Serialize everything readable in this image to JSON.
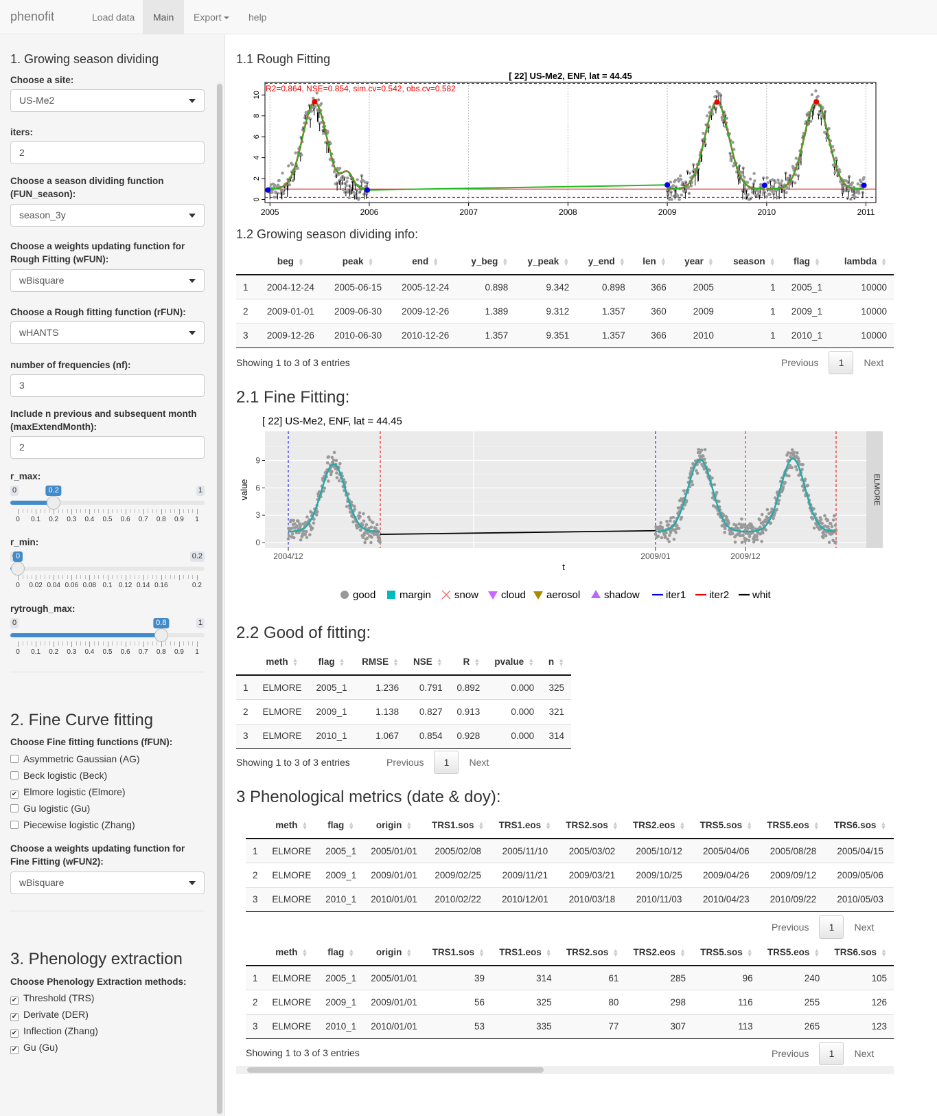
{
  "navbar": {
    "brand": "phenofit",
    "items": [
      "Load data",
      "Main",
      "Export",
      "help"
    ]
  },
  "sidebar": {
    "s1_title": "1. Growing season dividing",
    "site_label": "Choose a site:",
    "site_value": "US-Me2",
    "iters_label": "iters:",
    "iters_value": "2",
    "funseason_label": "Choose a season dividing function (FUN_season):",
    "funseason_value": "season_3y",
    "wfun_label": "Choose a weights updating function for Rough Fitting (wFUN):",
    "wfun_value": "wBisquare",
    "rfun_label": "Choose a Rough fitting function (rFUN):",
    "rfun_value": "wHANTS",
    "nf_label": "number of frequencies (nf):",
    "nf_value": "3",
    "maxext_label": "Include n previous and subsequent month (maxExtendMonth):",
    "maxext_value": "2",
    "sliders": [
      {
        "label": "r_max:",
        "min": "0",
        "max": "1",
        "value": "0.2",
        "value_num": 0.2,
        "min_num": 0,
        "max_num": 1,
        "ticks": [
          "0",
          "0.1",
          "0.2",
          "0.3",
          "0.4",
          "0.5",
          "0.6",
          "0.7",
          "0.8",
          "0.9",
          "1"
        ]
      },
      {
        "label": "r_min:",
        "min": "0",
        "max": "0.2",
        "value": "0",
        "value_num": 0,
        "min_num": 0,
        "max_num": 0.2,
        "ticks": [
          "0",
          "0.02",
          "0.04",
          "0.06",
          "0.08",
          "0.1",
          "0.12",
          "0.14",
          "0.16",
          "0.2"
        ]
      },
      {
        "label": "rytrough_max:",
        "min": "0",
        "max": "1",
        "value": "0.8",
        "value_num": 0.8,
        "min_num": 0,
        "max_num": 1,
        "ticks": [
          "0",
          "0.1",
          "0.2",
          "0.3",
          "0.4",
          "0.5",
          "0.6",
          "0.7",
          "0.8",
          "0.9",
          "1"
        ]
      }
    ],
    "s2_title": "2. Fine Curve fitting",
    "ffun_label": "Choose Fine fitting functions (fFUN):",
    "ffun_options": [
      {
        "label": "Asymmetric Gaussian (AG)",
        "checked": false
      },
      {
        "label": "Beck logistic (Beck)",
        "checked": false
      },
      {
        "label": "Elmore logistic (Elmore)",
        "checked": true
      },
      {
        "label": "Gu logistic (Gu)",
        "checked": false
      },
      {
        "label": "Piecewise logistic (Zhang)",
        "checked": false
      }
    ],
    "wfun2_label": "Choose a weights updating function for Fine Fitting (wFUN2):",
    "wfun2_value": "wBisquare",
    "s3_title": "3. Phenology extraction",
    "pheno_label": "Choose Phenology Extraction methods:",
    "pheno_options": [
      {
        "label": "Threshold (TRS)",
        "checked": true
      },
      {
        "label": "Derivate (DER)",
        "checked": true
      },
      {
        "label": "Inflection (Zhang)",
        "checked": true
      },
      {
        "label": "Gu (Gu)",
        "checked": true
      }
    ]
  },
  "main": {
    "h11": "1.1 Rough Fitting",
    "h12": "1.2 Growing season dividing info:",
    "h21": "2.1 Fine Fitting:",
    "h22": "2.2 Good of fitting:",
    "h3": "3 Phenological metrics (date & doy):",
    "pager": {
      "previous": "Previous",
      "page": "1",
      "next": "Next",
      "info": "Showing 1 to 3 of 3 entries"
    },
    "season_table": {
      "columns": [
        "",
        "beg",
        "peak",
        "end",
        "y_beg",
        "y_peak",
        "y_end",
        "len",
        "year",
        "season",
        "flag",
        "lambda"
      ],
      "rows": [
        [
          "1",
          "2004-12-24",
          "2005-06-15",
          "2005-12-24",
          "0.898",
          "9.342",
          "0.898",
          "366",
          "2005",
          "1",
          "2005_1",
          "10000"
        ],
        [
          "2",
          "2009-01-01",
          "2009-06-30",
          "2009-12-26",
          "1.389",
          "9.312",
          "1.357",
          "360",
          "2009",
          "1",
          "2009_1",
          "10000"
        ],
        [
          "3",
          "2009-12-26",
          "2010-06-30",
          "2010-12-26",
          "1.357",
          "9.351",
          "1.357",
          "366",
          "2010",
          "1",
          "2010_1",
          "10000"
        ]
      ]
    },
    "gof_table": {
      "columns": [
        "",
        "meth",
        "flag",
        "RMSE",
        "NSE",
        "R",
        "pvalue",
        "n"
      ],
      "rows": [
        [
          "1",
          "ELMORE",
          "2005_1",
          "1.236",
          "0.791",
          "0.892",
          "0.000",
          "325"
        ],
        [
          "2",
          "ELMORE",
          "2009_1",
          "1.138",
          "0.827",
          "0.913",
          "0.000",
          "321"
        ],
        [
          "3",
          "ELMORE",
          "2010_1",
          "1.067",
          "0.854",
          "0.928",
          "0.000",
          "314"
        ]
      ]
    },
    "date_table": {
      "columns": [
        "",
        "meth",
        "flag",
        "origin",
        "TRS1.sos",
        "TRS1.eos",
        "TRS2.sos",
        "TRS2.eos",
        "TRS5.sos",
        "TRS5.eos",
        "TRS6.sos"
      ],
      "rows": [
        [
          "1",
          "ELMORE",
          "2005_1",
          "2005/01/01",
          "2005/02/08",
          "2005/11/10",
          "2005/03/02",
          "2005/10/12",
          "2005/04/06",
          "2005/08/28",
          "2005/04/15"
        ],
        [
          "2",
          "ELMORE",
          "2009_1",
          "2009/01/01",
          "2009/02/25",
          "2009/11/21",
          "2009/03/21",
          "2009/10/25",
          "2009/04/26",
          "2009/09/12",
          "2009/05/06"
        ],
        [
          "3",
          "ELMORE",
          "2010_1",
          "2010/01/01",
          "2010/02/22",
          "2010/12/01",
          "2010/03/18",
          "2010/11/03",
          "2010/04/23",
          "2010/09/22",
          "2010/05/03"
        ]
      ]
    },
    "doy_table": {
      "columns": [
        "",
        "meth",
        "flag",
        "origin",
        "TRS1.sos",
        "TRS1.eos",
        "TRS2.sos",
        "TRS2.eos",
        "TRS5.sos",
        "TRS5.eos",
        "TRS6.sos"
      ],
      "rows": [
        [
          "1",
          "ELMORE",
          "2005_1",
          "2005/01/01",
          "39",
          "314",
          "61",
          "285",
          "96",
          "240",
          "105"
        ],
        [
          "2",
          "ELMORE",
          "2009_1",
          "2009/01/01",
          "56",
          "325",
          "80",
          "298",
          "116",
          "255",
          "126"
        ],
        [
          "3",
          "ELMORE",
          "2010_1",
          "2010/01/01",
          "53",
          "335",
          "77",
          "307",
          "113",
          "265",
          "123"
        ]
      ]
    }
  },
  "chart_data": [
    {
      "type": "scatter",
      "title": "[ 22] US-Me2, ENF, lat = 44.45",
      "annotation": "R2=0.864, NSE=0.854, sim.cv=0.542, obs.cv=0.582",
      "x_ticks": [
        "2005",
        "2006",
        "2007",
        "2008",
        "2009",
        "2010",
        "2011"
      ],
      "y_ticks": [
        "0",
        "2",
        "4",
        "6",
        "8",
        "10"
      ],
      "xlim": [
        2004.95,
        2011.1
      ],
      "ylim": [
        -0.3,
        11.2
      ],
      "reference_lines": {
        "red_solid": 1.0,
        "red_dashed": [
          0.2,
          11.1
        ]
      },
      "peaks": [
        [
          2005.45,
          9.342
        ],
        [
          2009.5,
          9.312
        ],
        [
          2010.5,
          9.351
        ]
      ],
      "troughs": [
        [
          2004.98,
          0.898
        ],
        [
          2005.98,
          0.898
        ],
        [
          2009.0,
          1.389
        ],
        [
          2009.98,
          1.357
        ],
        [
          2010.98,
          1.357
        ]
      ],
      "colors": {
        "obs": "#999999",
        "smooth": "#22bb22",
        "raw_fit": "#ee2222",
        "peak": "#ee0000",
        "trough": "#0000ee",
        "ref": "#dd0000"
      }
    },
    {
      "type": "scatter",
      "title": "[ 22] US-Me2, ENF, lat = 44.45",
      "xlabel": "t",
      "ylabel": "value",
      "x_ticks": [
        "2004/12",
        "2009/01",
        "2009/12"
      ],
      "y_ticks": [
        "0",
        "3",
        "6",
        "9"
      ],
      "ylim": [
        -0.6,
        12.2
      ],
      "facet_label": "ELMORE",
      "legend": [
        "good",
        "margin",
        "snow",
        "cloud",
        "aerosol",
        "shadow",
        "iter1",
        "iter2",
        "whit"
      ],
      "legend_position": "bottom",
      "seasons": [
        {
          "start": "2004/12",
          "peak": 8.6
        },
        {
          "start": "2009/01",
          "peak": 9.1
        },
        {
          "start": "2009/12",
          "peak": 9.2
        }
      ],
      "colors": {
        "good": "#999999",
        "margin": "#00bbbb",
        "snow": "#ff6666",
        "cloud": "#cc66ff",
        "aerosol": "#aa8800",
        "shadow": "#bb66ff",
        "iter1": "#0000ee",
        "iter2": "#ee0000",
        "whit": "#000000",
        "fit": "#22aaaa"
      }
    }
  ]
}
